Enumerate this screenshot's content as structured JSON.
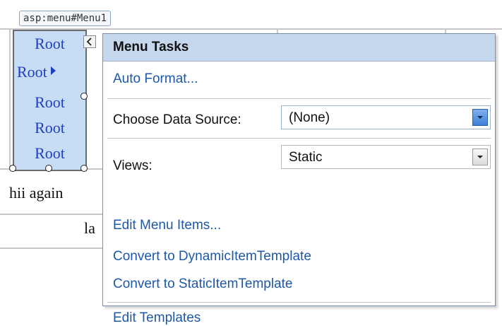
{
  "designer": {
    "control_tag": "asp:menu#Menu1",
    "root_items": [
      "Root",
      "Root",
      "Root",
      "Root",
      "Root"
    ],
    "text_hii": "hii again",
    "text_la": "la"
  },
  "smart_tag": {
    "title": "Menu Tasks",
    "auto_format": "Auto Format...",
    "data_source_label": "Choose Data Source:",
    "data_source_value": "(None)",
    "views_label": "Views:",
    "views_value": "Static",
    "edit_menu_items": "Edit Menu Items...",
    "convert_dynamic": "Convert to DynamicItemTemplate",
    "convert_static": "Convert to StaticItemTemplate",
    "edit_templates": "Edit Templates"
  },
  "icons": {
    "collapse": "chevron-left-icon",
    "submenu": "arrow-right-icon",
    "dropdown": "chevron-down-icon"
  },
  "colors": {
    "header_bg": "#c5d8ee",
    "link": "#1e58a8",
    "menu_item_text": "#1f3fbf",
    "menu_bg": "#c7dcf5"
  }
}
